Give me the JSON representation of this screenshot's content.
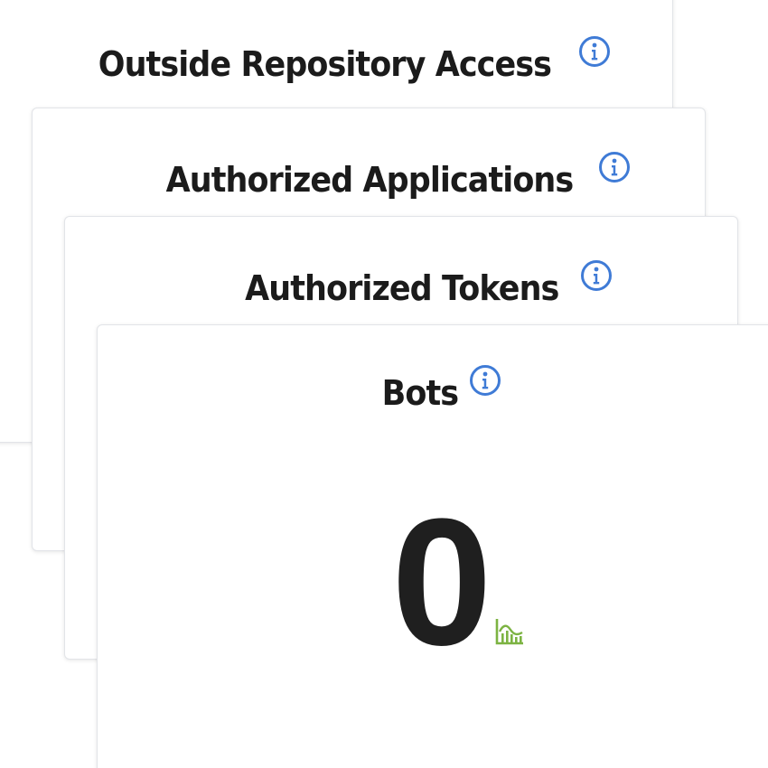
{
  "cards": [
    {
      "title": "Outside Repository Access",
      "info_icon": "info-icon"
    },
    {
      "title": "Authorized Applications",
      "info_icon": "info-icon"
    },
    {
      "title": "Authorized Tokens",
      "info_icon": "info-icon"
    },
    {
      "title": "Bots",
      "info_icon": "info-icon",
      "value": "0",
      "trend_icon": "area-chart-icon"
    }
  ],
  "colors": {
    "info_icon": "#3f7bd6",
    "trend_icon": "#7cb342",
    "title_text": "#1b1b1b",
    "value_text": "#1f1f1f"
  }
}
